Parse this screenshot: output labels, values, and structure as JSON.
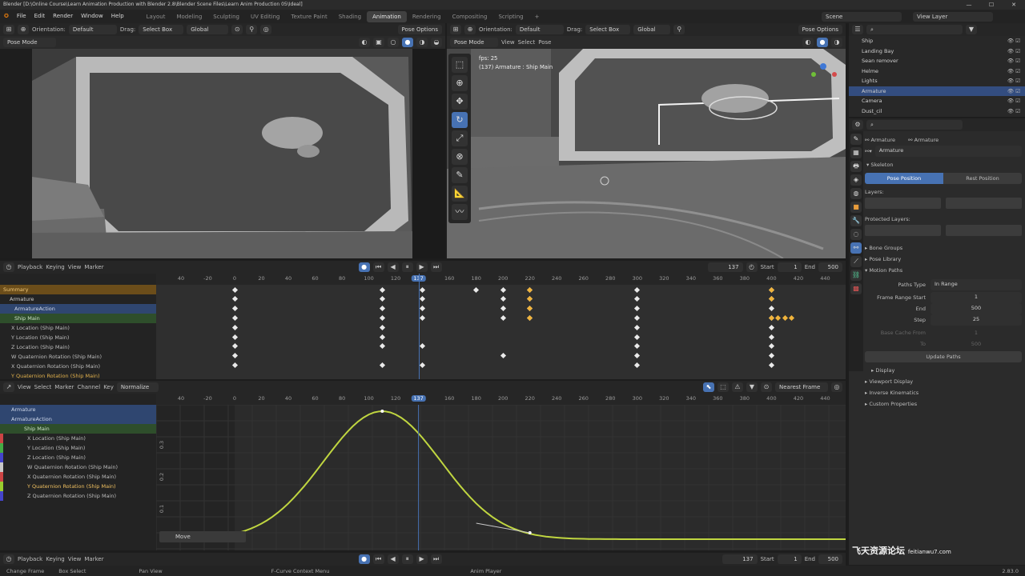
{
  "window": {
    "title": "Blender [D:\\Online Course\\Learn Animation Production with Blender 2.8\\Blender Scene Files\\Learn Anim Production 05\\Ideal]",
    "controls": [
      "—",
      "☐",
      "✕"
    ]
  },
  "menubar": {
    "items": [
      "File",
      "Edit",
      "Render",
      "Window",
      "Help"
    ],
    "workspaces": [
      "Layout",
      "Modeling",
      "Sculpting",
      "UV Editing",
      "Texture Paint",
      "Shading",
      "Animation",
      "Rendering",
      "Compositing",
      "Scripting"
    ],
    "add_tab": "+",
    "scene": "Scene",
    "view_layer": "View Layer"
  },
  "viewport_left": {
    "orientation_label": "Orientation:",
    "orientation": "Default",
    "drag_label": "Drag:",
    "drag": "Select Box",
    "transform": "Global",
    "pose_options": "Pose Options",
    "mode": "Pose Mode"
  },
  "viewport_right": {
    "orientation_label": "Orientation:",
    "orientation": "Default",
    "drag_label": "Drag:",
    "drag": "Select Box",
    "transform": "Global",
    "pose_options": "Pose Options",
    "mode": "Pose Mode",
    "menus": [
      "View",
      "Select",
      "Pose"
    ],
    "overlay_fps": "fps: 25",
    "overlay_object": "(137) Armature : Ship Main"
  },
  "timeline": {
    "menus": [
      "Playback",
      "Keying",
      "View",
      "Marker"
    ],
    "current_frame": "137",
    "start_label": "Start",
    "start": "1",
    "end_label": "End",
    "end": "500"
  },
  "dopesheet": {
    "ruler": [
      "40",
      "-20",
      "0",
      "20",
      "40",
      "60",
      "80",
      "100",
      "120",
      "137",
      "160",
      "180",
      "200",
      "220",
      "240",
      "260",
      "280",
      "300",
      "320",
      "340",
      "360",
      "380",
      "400",
      "420",
      "440"
    ],
    "channels": [
      "Summary",
      "Armature",
      "ArmatureAction",
      "Ship Main",
      "X Location (Ship Main)",
      "Y Location (Ship Main)",
      "Z Location (Ship Main)",
      "W Quaternion Rotation (Ship Main)",
      "X Quaternion Rotation (Ship Main)",
      "Y Quaternion Rotation (Ship Main)"
    ],
    "keyframes": [
      {
        "row": 0,
        "frames": [
          0,
          110,
          140,
          180,
          200,
          220,
          300,
          400
        ]
      },
      {
        "row": 1,
        "frames": [
          0,
          110,
          140,
          200,
          220,
          300,
          400
        ]
      },
      {
        "row": 2,
        "frames": [
          0,
          110,
          140,
          200,
          220,
          300,
          400
        ]
      },
      {
        "row": 3,
        "frames": [
          0,
          110,
          140,
          200,
          220,
          300,
          400
        ]
      },
      {
        "row": 4,
        "frames": [
          0,
          110,
          300,
          400
        ]
      },
      {
        "row": 5,
        "frames": [
          0,
          110,
          300,
          400
        ]
      },
      {
        "row": 6,
        "frames": [
          0,
          110,
          140,
          300,
          400
        ]
      },
      {
        "row": 7,
        "frames": [
          0,
          200,
          300,
          400
        ]
      },
      {
        "row": 8,
        "frames": [
          0,
          110,
          140,
          300,
          400
        ]
      }
    ],
    "selected_keys": [
      {
        "row": 0,
        "frames": [
          220,
          400
        ]
      },
      {
        "row": 1,
        "frames": [
          220,
          400
        ]
      },
      {
        "row": 2,
        "frames": [
          220
        ]
      },
      {
        "row": 3,
        "frames": [
          220,
          400,
          405,
          410,
          415
        ]
      }
    ]
  },
  "graph": {
    "menus": [
      "View",
      "Select",
      "Marker",
      "Channel",
      "Key"
    ],
    "normalize": "Normalize",
    "snap": "Nearest Frame",
    "ruler": [
      "40",
      "-20",
      "0",
      "20",
      "40",
      "60",
      "80",
      "100",
      "120",
      "137",
      "160",
      "180",
      "200",
      "220",
      "240",
      "260",
      "280",
      "300",
      "320",
      "340",
      "360",
      "380",
      "400",
      "420",
      "440"
    ],
    "channels": [
      "Armature",
      "ArmatureAction",
      "Ship Main",
      "X Location (Ship Main)",
      "Y Location (Ship Main)",
      "Z Location (Ship Main)",
      "W Quaternion Rotation (Ship Main)",
      "X Quaternion Rotation (Ship Main)",
      "Y Quaternion Rotation (Ship Main)",
      "Z Quaternion Rotation (Ship Main)"
    ],
    "y_ticks": [
      "0.3",
      "0.2",
      "0.1"
    ],
    "operator_panel": "Move"
  },
  "timeline_bottom": {
    "menus": [
      "Playback",
      "Keying",
      "View",
      "Marker"
    ],
    "current_frame": "137",
    "start_label": "Start",
    "start": "1",
    "end_label": "End",
    "end": "500"
  },
  "statusbar": {
    "items": [
      "Change Frame",
      "Box Select",
      "Pan View",
      "F-Curve Context Menu",
      "Anim Player"
    ],
    "version": "2.83.0"
  },
  "outliner": {
    "items": [
      {
        "label": "Ship",
        "selected": false
      },
      {
        "label": "Landing Bay",
        "selected": false
      },
      {
        "label": "Sean remover",
        "selected": false
      },
      {
        "label": "Helme",
        "selected": false
      },
      {
        "label": "Lights",
        "selected": false
      },
      {
        "label": "Armature",
        "selected": true
      },
      {
        "label": "Camera",
        "selected": false
      },
      {
        "label": "Dust_cil",
        "selected": false
      }
    ]
  },
  "properties": {
    "object": "Armature",
    "data": "Armature",
    "name_field": "Armature",
    "skeleton": "Skeleton",
    "pose_position": "Pose Position",
    "rest_position": "Rest Position",
    "layers": "Layers:",
    "protected_layers": "Protected Layers:",
    "panels_collapsed": [
      "Bone Groups",
      "Pose Library"
    ],
    "motion_paths": "Motion Paths",
    "path_type_label": "Paths Type",
    "path_type": "In Range",
    "range_start_label": "Frame Range Start",
    "range_start": "1",
    "end_label": "End",
    "end": "500",
    "step_label": "Step",
    "step": "25",
    "cache_from_label": "Base Cache From",
    "cache_from": "1",
    "to_label": "To",
    "to": "500",
    "update_paths": "Update Paths",
    "display": "Display",
    "panels_bottom": [
      "Viewport Display",
      "Inverse Kinematics",
      "Custom Properties"
    ]
  },
  "watermark": {
    "text_cn": "飞天资源论坛",
    "text_url": "feitianwu7.com"
  },
  "colors": {
    "accent": "#4772b3",
    "curve": "#c0d640",
    "keyframe_selected": "#f0b33b",
    "playhead": "#4772b3",
    "summary": "#7a5a1e"
  }
}
